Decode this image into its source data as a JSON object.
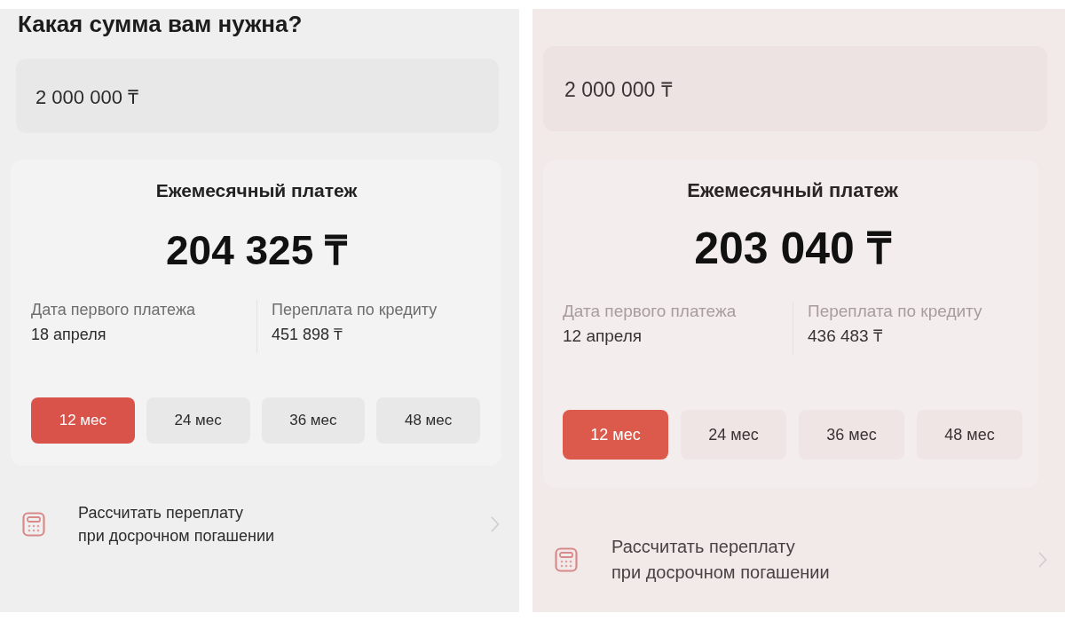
{
  "panels": [
    {
      "title": "Какая сумма вам нужна?",
      "amount_field": {
        "value": "2 000 000 ₸"
      },
      "payment_card": {
        "heading": "Ежемесячный платеж",
        "amount": "204 325 ₸",
        "details": [
          {
            "label": "Дата первого платежа",
            "value": "18 апреля"
          },
          {
            "label": "Переплата по кредиту",
            "value": "451 898 ₸"
          }
        ],
        "terms": [
          {
            "label": "12 мес",
            "selected": true
          },
          {
            "label": "24 мес",
            "selected": false
          },
          {
            "label": "36 мес",
            "selected": false
          },
          {
            "label": "48 мес",
            "selected": false
          }
        ]
      },
      "action": {
        "text": "Рассчитать переплату\nпри досрочном погашении"
      }
    },
    {
      "amount_field": {
        "value": "2 000 000 ₸"
      },
      "payment_card": {
        "heading": "Ежемесячный платеж",
        "amount": "203 040 ₸",
        "details": [
          {
            "label": "Дата первого платежа",
            "value": "12 апреля"
          },
          {
            "label": "Переплата по кредиту",
            "value": "436 483 ₸"
          }
        ],
        "terms": [
          {
            "label": "12 мес",
            "selected": true
          },
          {
            "label": "24 мес",
            "selected": false
          },
          {
            "label": "36 мес",
            "selected": false
          },
          {
            "label": "48 мес",
            "selected": false
          }
        ]
      },
      "action": {
        "text": "Рассчитать переплату\nпри досрочном погашении"
      }
    }
  ]
}
